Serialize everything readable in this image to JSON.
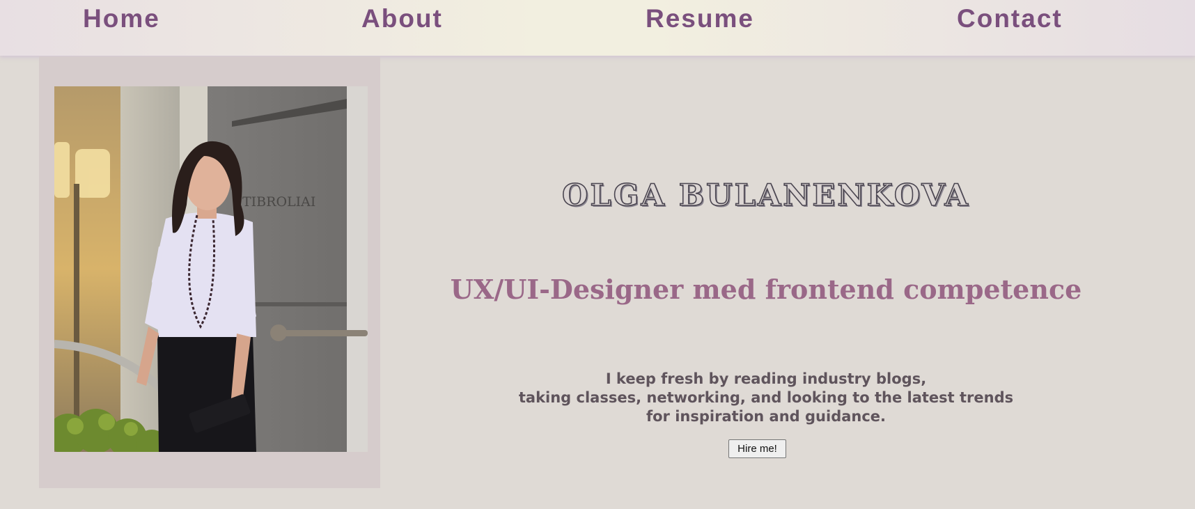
{
  "nav": {
    "home": "Home",
    "about": "About",
    "resume": "Resume",
    "contact": "Contact"
  },
  "profile": {
    "name": "OLGA BULANENKOVA",
    "title": "UX/UI-Designer med frontend competence",
    "blurb": [
      "I keep fresh by reading industry blogs,",
      "taking classes, networking, and looking to the latest trends",
      "for inspiration and guidance."
    ],
    "cta_label": "Hire me!"
  },
  "photo": {
    "sign_text": "TIBROLIAI"
  },
  "colors": {
    "background": "#dfdad5",
    "nav_text": "#7a4f7d",
    "subtitle": "#9a6888",
    "blurb_text": "#5f545c",
    "photo_panel": "#d6cccc"
  }
}
